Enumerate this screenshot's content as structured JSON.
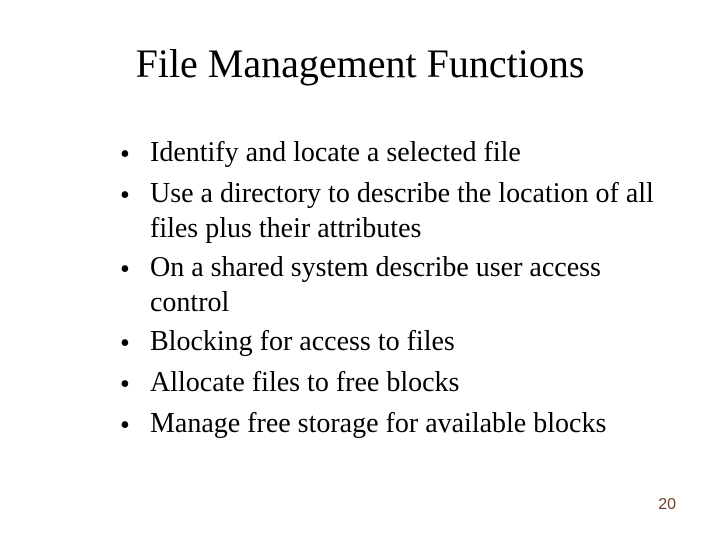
{
  "slide": {
    "title": "File Management Functions",
    "bullets": [
      "Identify and locate a selected file",
      "Use a directory to describe the location of all files plus their attributes",
      "On a shared system describe user access control",
      "Blocking for access to files",
      "Allocate files to free blocks",
      "Manage free storage for available blocks"
    ],
    "page_number": "20"
  }
}
